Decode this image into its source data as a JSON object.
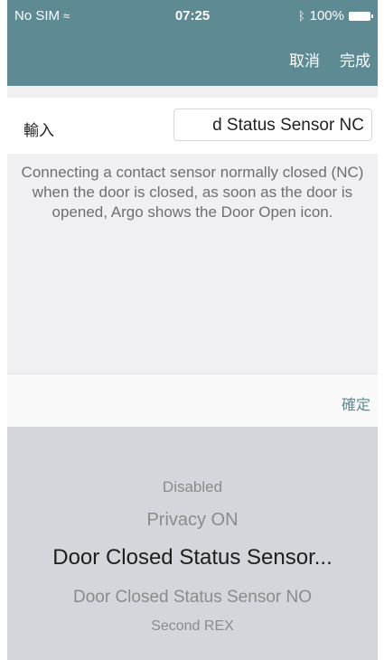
{
  "status_bar": {
    "carrier": "No SIM",
    "time": "07:25",
    "battery": "100%"
  },
  "nav": {
    "cancel_label": "取消",
    "done_label": "完成"
  },
  "input": {
    "label": "輸入",
    "value": "d Status Sensor NC"
  },
  "description": "Connecting a contact sensor normally closed (NC) when the door is closed, as soon as the door is opened, Argo shows the Door Open icon.",
  "confirm_label": "確定",
  "picker": {
    "options": [
      "Disabled",
      "Privacy ON",
      "Door Closed Status Sensor...",
      "Door Closed Status Sensor NO",
      "Second REX"
    ],
    "selected": "Door Closed Status Sensor..."
  },
  "colors": {
    "nav_bar": "#5d8a93",
    "picker_bg": "#d4d6db",
    "accent": "#5d8a93"
  }
}
